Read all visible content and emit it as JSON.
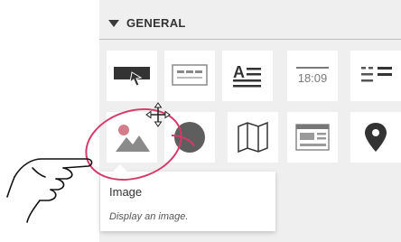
{
  "section": {
    "title": "GENERAL"
  },
  "tiles": [
    {
      "name": "tile-hero",
      "icon": "hero-banner-icon"
    },
    {
      "name": "tile-form",
      "icon": "form-icon"
    },
    {
      "name": "tile-text",
      "icon": "text-icon"
    },
    {
      "name": "tile-clock",
      "icon": "clock-icon",
      "text": "18:09"
    },
    {
      "name": "tile-list",
      "icon": "list-icon"
    },
    {
      "name": "tile-image",
      "icon": "image-icon"
    },
    {
      "name": "tile-circle",
      "icon": "circle-icon"
    },
    {
      "name": "tile-map",
      "icon": "map-icon"
    },
    {
      "name": "tile-card",
      "icon": "card-layout-icon"
    },
    {
      "name": "tile-location",
      "icon": "location-pin-icon"
    }
  ],
  "tooltip": {
    "title": "Image",
    "description": "Display an image."
  },
  "colors": {
    "icon_dark": "#333333",
    "icon_gray": "#7a7a7a",
    "highlight": "#d63a6a",
    "panel_bg": "#efefef"
  }
}
